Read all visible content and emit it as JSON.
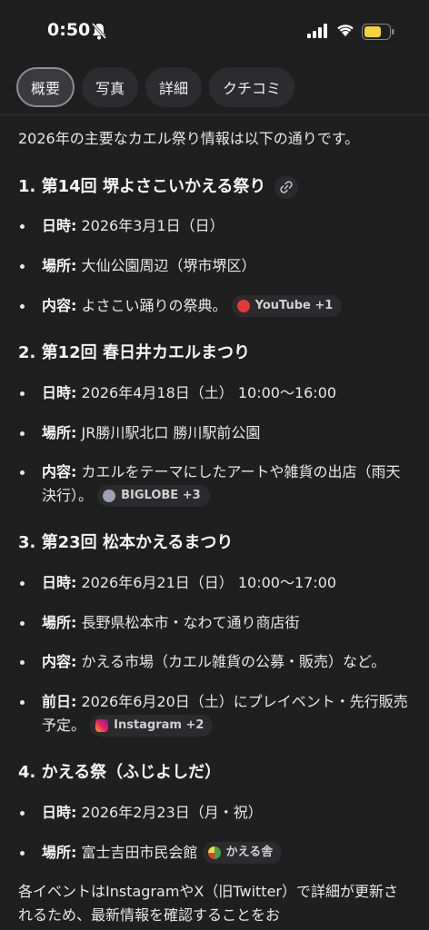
{
  "status": {
    "time": "0:50"
  },
  "tabs": [
    "概要",
    "写真",
    "詳細",
    "クチコミ"
  ],
  "intro": "2026年の主要なカエル祭り情報は以下の通りです。",
  "events": [
    {
      "heading": "1. 第14回 堺よさこいかえる祭り",
      "items": [
        {
          "label": "日時:",
          "text": " 2026年3月1日（日）"
        },
        {
          "label": "場所:",
          "text": " 大仙公園周辺（堺市堺区）"
        },
        {
          "label": "内容:",
          "text": " よさこい踊りの祭典。"
        }
      ],
      "chip": "YouTube +1"
    },
    {
      "heading": "2. 第12回 春日井カエルまつり",
      "items": [
        {
          "label": "日時:",
          "text": " 2026年4月18日（土） 10:00〜16:00"
        },
        {
          "label": "場所:",
          "text": " JR勝川駅北口 勝川駅前公園"
        },
        {
          "label": "内容:",
          "text": " カエルをテーマにしたアートや雑貨の出店（雨天決行）。"
        }
      ],
      "chip": "BIGLOBE +3"
    },
    {
      "heading": "3. 第23回 松本かえるまつり",
      "items": [
        {
          "label": "日時:",
          "text": " 2026年6月21日（日） 10:00〜17:00"
        },
        {
          "label": "場所:",
          "text": " 長野県松本市・なわて通り商店街"
        },
        {
          "label": "内容:",
          "text": " かえる市場（カエル雑貨の公募・販売）など。"
        },
        {
          "label": "前日:",
          "text": " 2026年6月20日（土）にプレイベント・先行販売予定。"
        }
      ],
      "chip": "Instagram +2"
    },
    {
      "heading": "4. かえる祭（ふじよしだ）",
      "items": [
        {
          "label": "日時:",
          "text": " 2026年2月23日（月・祝）"
        },
        {
          "label": "場所:",
          "text": " 富士吉田市民会館"
        }
      ],
      "chip": "かえる舎"
    }
  ],
  "footer": "各イベントはInstagramやX（旧Twitter）で詳細が更新されるため、最新情報を確認することをお",
  "colors": {
    "background": "#1f1f1f",
    "battery": "#f5d33b",
    "youtube": "#e53935"
  }
}
